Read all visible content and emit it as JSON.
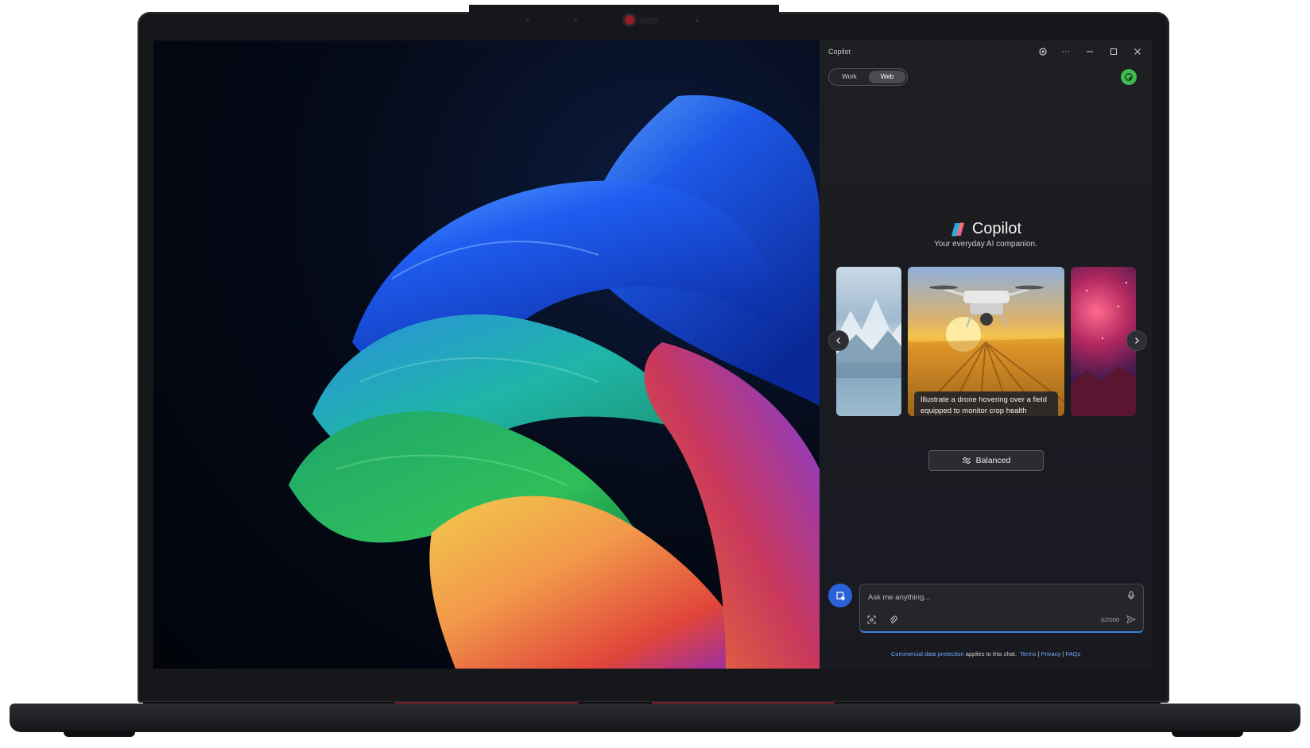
{
  "app_title": "Copilot",
  "modes": {
    "work": "Work",
    "web": "Web"
  },
  "brand": {
    "name": "Copilot",
    "tagline": "Your everyday AI companion."
  },
  "carousel": {
    "caption": "Illustrate a drone hovering over a field equipped to monitor crop health"
  },
  "conversation_style": "Balanced",
  "compose": {
    "placeholder": "Ask me anything...",
    "counter": "0/2000"
  },
  "footer": {
    "cdp_link": "Commercial data protection",
    "cdp_text": " applies to this chat.",
    "terms": "Terms",
    "privacy": "Privacy",
    "faqs": "FAQs",
    "sep": " | "
  },
  "colors": {
    "accent": "#2c62d9",
    "avatar": "#3fb950",
    "link": "#6ea8fe",
    "laptop_accent": "#9a1d22"
  }
}
